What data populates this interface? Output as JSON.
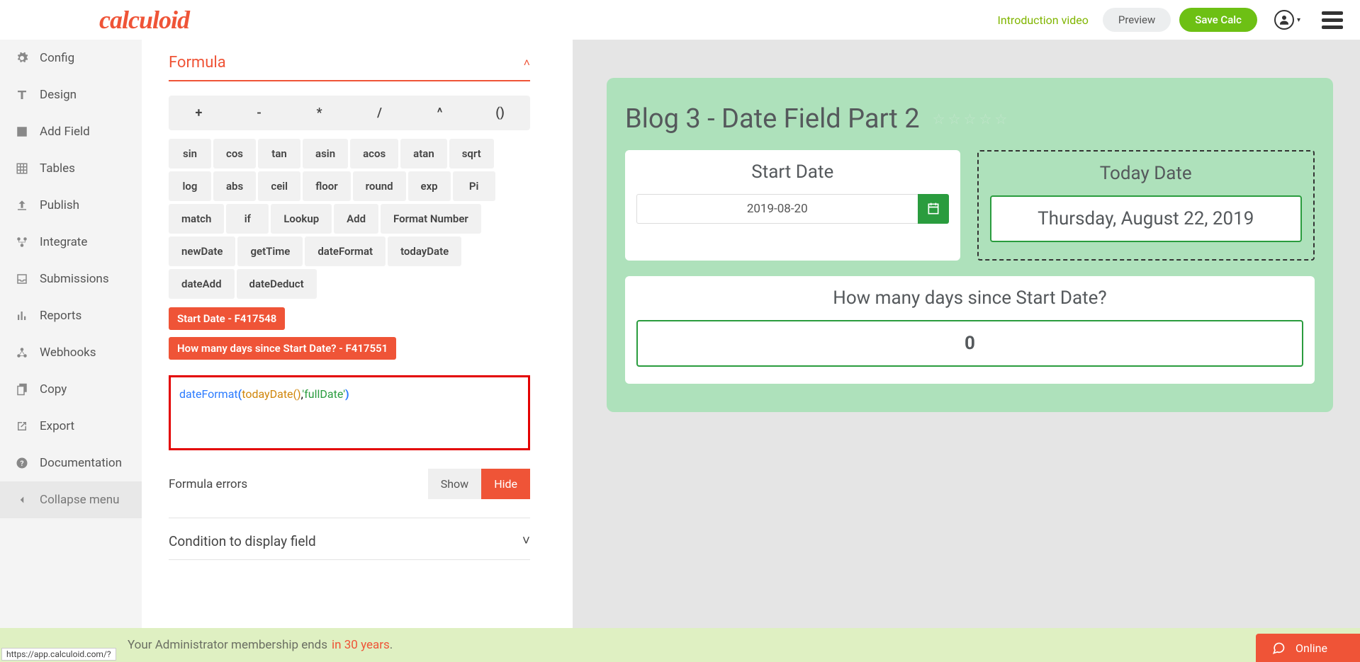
{
  "brand": "calculoid",
  "header": {
    "intro_link": "Introduction video",
    "preview": "Preview",
    "save": "Save Calc"
  },
  "sidebar": {
    "items": [
      {
        "label": "Config"
      },
      {
        "label": "Design"
      },
      {
        "label": "Add Field"
      },
      {
        "label": "Tables"
      },
      {
        "label": "Publish"
      },
      {
        "label": "Integrate"
      },
      {
        "label": "Submissions"
      },
      {
        "label": "Reports"
      },
      {
        "label": "Webhooks"
      },
      {
        "label": "Copy"
      },
      {
        "label": "Export"
      },
      {
        "label": "Documentation"
      }
    ],
    "collapse": "Collapse menu"
  },
  "editor": {
    "section_title": "Formula",
    "operators": [
      "+",
      "-",
      "*",
      "/",
      "^",
      "()"
    ],
    "functions": [
      "sin",
      "cos",
      "tan",
      "asin",
      "acos",
      "atan",
      "sqrt",
      "log",
      "abs",
      "ceil",
      "floor",
      "round",
      "exp",
      "Pi",
      "match",
      "if",
      "Lookup",
      "Add",
      "Format Number",
      "newDate",
      "getTime",
      "dateFormat",
      "todayDate",
      "dateAdd",
      "dateDeduct"
    ],
    "field_refs": [
      "Start Date - F417548",
      "How many days since Start Date? - F417551"
    ],
    "formula_tokens": {
      "fn": "dateFormat",
      "open": "(",
      "call": "todayDate()",
      "comma": ",",
      "str": "'fullDate'",
      "close": ")"
    },
    "errors_label": "Formula errors",
    "show": "Show",
    "hide": "Hide",
    "condition_label": "Condition to display field"
  },
  "canvas": {
    "title": "Blog 3 - Date Field Part 2",
    "start_date_label": "Start Date",
    "start_date_value": "2019-08-20",
    "today_label": "Today Date",
    "today_value": "Thursday, August 22, 2019",
    "days_label": "How many days since Start Date?",
    "days_value": "0"
  },
  "membership": {
    "text": "Your Administrator membership ends",
    "years": "in 30 years",
    "dot": "."
  },
  "status_url": "https://app.calculoid.com/?",
  "chat": {
    "label": "Online"
  }
}
